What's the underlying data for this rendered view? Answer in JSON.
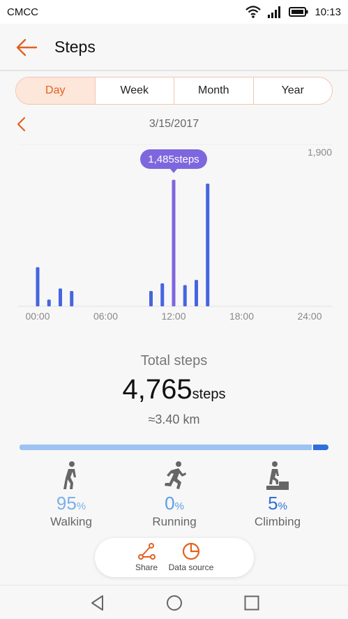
{
  "status_bar": {
    "carrier": "CMCC",
    "time": "10:13",
    "icons": [
      "wifi-icon",
      "signal-icon",
      "battery-icon"
    ]
  },
  "header": {
    "title": "Steps",
    "back_icon": "arrow-left-icon"
  },
  "tabs": [
    {
      "label": "Day",
      "active": true
    },
    {
      "label": "Week",
      "active": false
    },
    {
      "label": "Month",
      "active": false
    },
    {
      "label": "Year",
      "active": false
    }
  ],
  "date_nav": {
    "date": "3/15/2017",
    "prev_icon": "chevron-left-icon"
  },
  "chart_data": {
    "type": "bar",
    "title": "",
    "xlabel": "",
    "ylabel": "",
    "x_tick_labels": [
      "00:00",
      "06:00",
      "12:00",
      "18:00",
      "24:00"
    ],
    "x_range_hours": [
      0,
      24
    ],
    "ylim": [
      0,
      1900
    ],
    "y_max_label": "1,900",
    "bar_color": "#4665de",
    "highlight_color": "#7e67de",
    "bars": [
      {
        "hour": 0,
        "value": 460
      },
      {
        "hour": 1,
        "value": 80
      },
      {
        "hour": 2,
        "value": 210
      },
      {
        "hour": 3,
        "value": 180
      },
      {
        "hour": 10,
        "value": 180
      },
      {
        "hour": 11,
        "value": 270
      },
      {
        "hour": 12,
        "value": 1485
      },
      {
        "hour": 13,
        "value": 250
      },
      {
        "hour": 14,
        "value": 310
      },
      {
        "hour": 15,
        "value": 1440
      }
    ],
    "highlight_index": 6,
    "tooltip_text": "1,485steps",
    "grid": false
  },
  "summary": {
    "label": "Total steps",
    "total": "4,765",
    "unit": "steps",
    "distance": "≈3.40 km",
    "walking_fraction": 0.95
  },
  "activities": [
    {
      "name": "walking",
      "icon": "walking-person-icon",
      "percent": "95",
      "symbol": "%",
      "label": "Walking",
      "color": "#7ab0ec"
    },
    {
      "name": "running",
      "icon": "running-person-icon",
      "percent": "0",
      "symbol": "%",
      "label": "Running",
      "color": "#5b9de8"
    },
    {
      "name": "climbing",
      "icon": "climbing-stairs-icon",
      "percent": "5",
      "symbol": "%",
      "label": "Climbing",
      "color": "#2e6fdb"
    }
  ],
  "actions": [
    {
      "label": "Share",
      "icon": "share-icon"
    },
    {
      "label": "Data source",
      "icon": "pie-chart-icon"
    }
  ],
  "accent_color": "#e2611f",
  "nav_bar": {
    "icons": [
      "back-triangle-icon",
      "home-circle-icon",
      "recents-square-icon"
    ]
  }
}
